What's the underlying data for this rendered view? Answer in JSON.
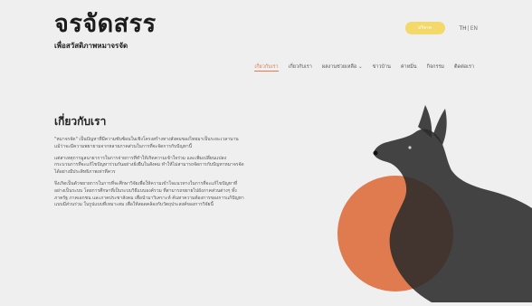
{
  "brand": {
    "title": "จรจัดสรร",
    "subtitle": "เพื่อสวัสดิภาพหมาจรจัด"
  },
  "header": {
    "donate_label": "บริจาค",
    "lang_th": "TH",
    "lang_sep": "|",
    "lang_en": "EN"
  },
  "nav": {
    "items": [
      {
        "label": "เกี่ยวกับเรา"
      },
      {
        "label": "เกี่ยวกับเรา"
      },
      {
        "label": "ผลงานช่วยเหลือ ⌄"
      },
      {
        "label": "ข่าวบ้าน"
      },
      {
        "label": "ค่าหมิ่น"
      },
      {
        "label": "กิจกรรม"
      },
      {
        "label": "ติดต่อเรา"
      }
    ]
  },
  "about": {
    "heading": "เกี่ยวกับเรา",
    "paragraphs": [
      "\"หมาจรจัด\" เป็นปัญหาที่มีความซับซ้อนในเชิงโครงสร้างทางสังคมของไทยมาเป็นระยะเวลานาน แม้ว่าจะมีความพยายามจากหลายภาคส่วนในการที่จะจัดการกับปัญหานี้",
      "แต่สาเหตุการมูลนายาการในการจ่ายการที่ทำให้เกิดความเข้าใจร่วม และเพิ่มเปลี่ยนแปลงกระบวนการที่จะแก้ไขปัญหาร่วมกันอย่างยั่งยืนในสังคม ทำให้ไม่สามารถจัดการกับปัญหาหมาจรจัดได้อย่างมีประสิทธิภาพเท่าที่ควร",
      "จึงเกิดเป็นตัวขยายการในการที่จะศึกษาวิจัยเพื่อให้ความเข้าใจแนวทางในการที่จะแก้ไขปัญหาที่อย่างเป็นระบบ โดยการศึกษาที่เป็นระบบวิธีแบบองค์รวม ที่สามารถขยายไปยังภาคส่วนต่างๆ ทั้งภาครัฐ ภาคเอกชน และภาคประชาสังคม เพื่อนำมาวิเคราะห์ ค้นหาความต้องการของการแก้ปัญหาแบบมีส่วนร่วม ในรูปแบบที่เหมาะสม เพื่อให้สอดคล้องกับวัตถุประสงค์ของการวิจัยนี้"
    ]
  },
  "hero": {
    "circle_color": "#e07b4f",
    "dog_color": "#2b2b2b"
  }
}
